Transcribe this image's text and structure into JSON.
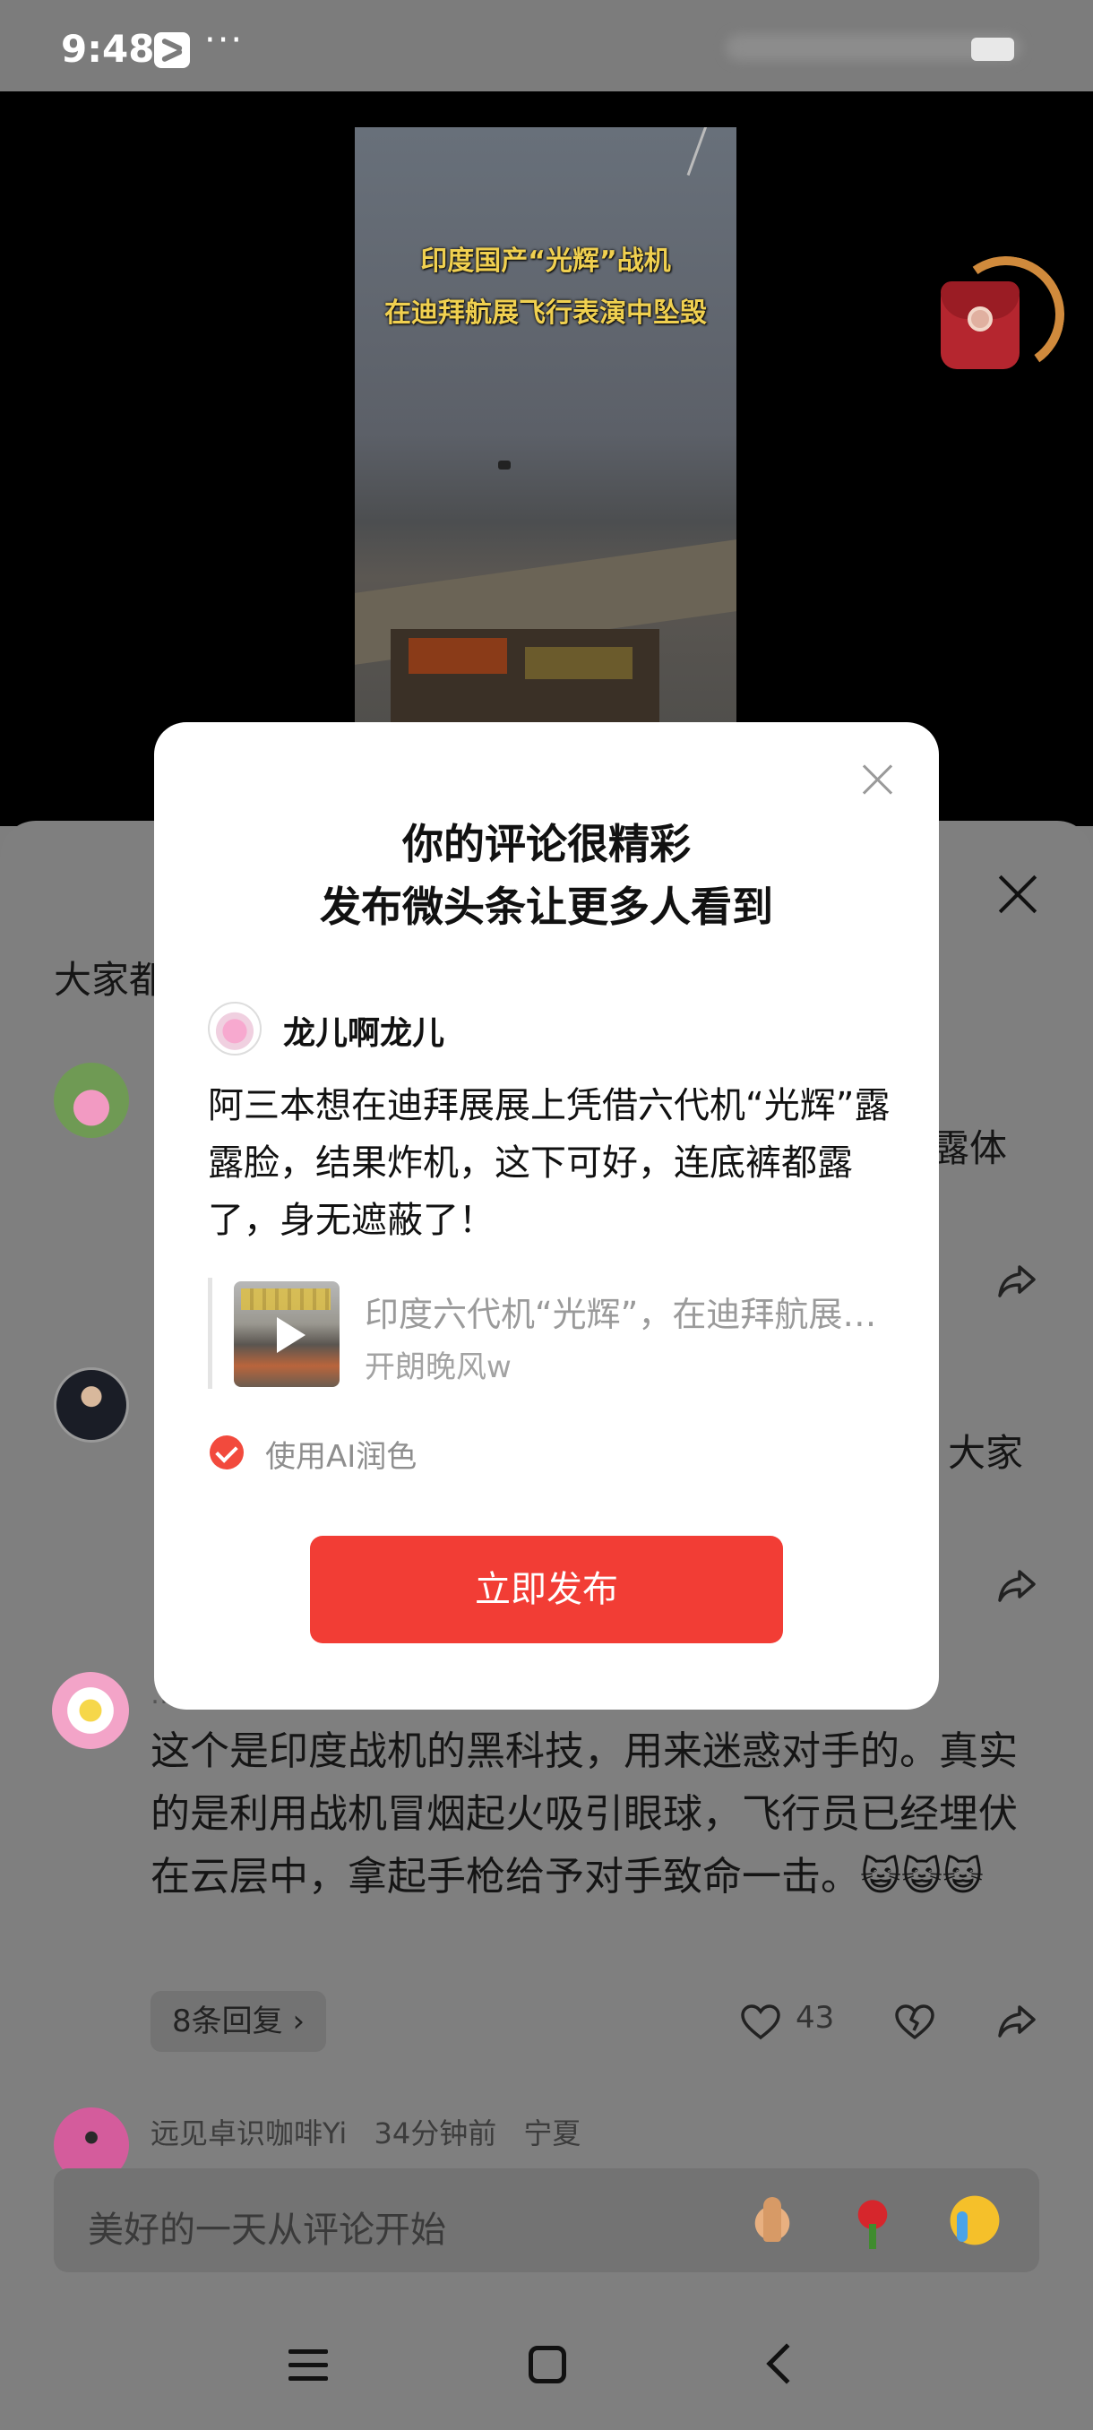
{
  "status_bar": {
    "time": "9:48",
    "more": "···"
  },
  "video": {
    "caption_line1": "印度国产“光辉”战机",
    "caption_line2": "在迪拜航展飞行表演中坠毁"
  },
  "comments_sheet": {
    "title_fragment": "大家都",
    "comment1_tail": "露体",
    "comment2_tail": "大家",
    "comment3": {
      "author_fragment": "…",
      "text": "这个是印度战机的黑科技，用来迷惑对手的。真实的是利用战机冒烟起火吸引眼球，飞行员已经埋伏在云层中，拿起手枪给予对手致命一击。😺😺😺",
      "replies_label": "8条回复 ›",
      "like_count": "43"
    },
    "comment4": {
      "author": "远见卓识咖啡Yi",
      "time": "34分钟前",
      "location": "宁夏"
    }
  },
  "input_bar": {
    "placeholder": "美好的一天从评论开始"
  },
  "modal": {
    "title_line1": "你的评论很精彩",
    "title_line2": "发布微头条让更多人看到",
    "user_name": "龙儿啊龙儿",
    "comment": "阿三本想在迪拜展展上凭借六代机“光辉”露露脸，结果炸机，这下可好，连底裤都露了，身无遮蔽了！",
    "quoted_title": "印度六代机“光辉”，在迪拜航展飞行表演中坠毁",
    "quoted_author": "开朗晚风w",
    "ai_option_label": "使用AI润色",
    "ai_option_checked": true,
    "publish_label": "立即发布"
  },
  "colors": {
    "accent": "#f23d35",
    "overlay": "rgba(0,0,0,0.5)"
  }
}
